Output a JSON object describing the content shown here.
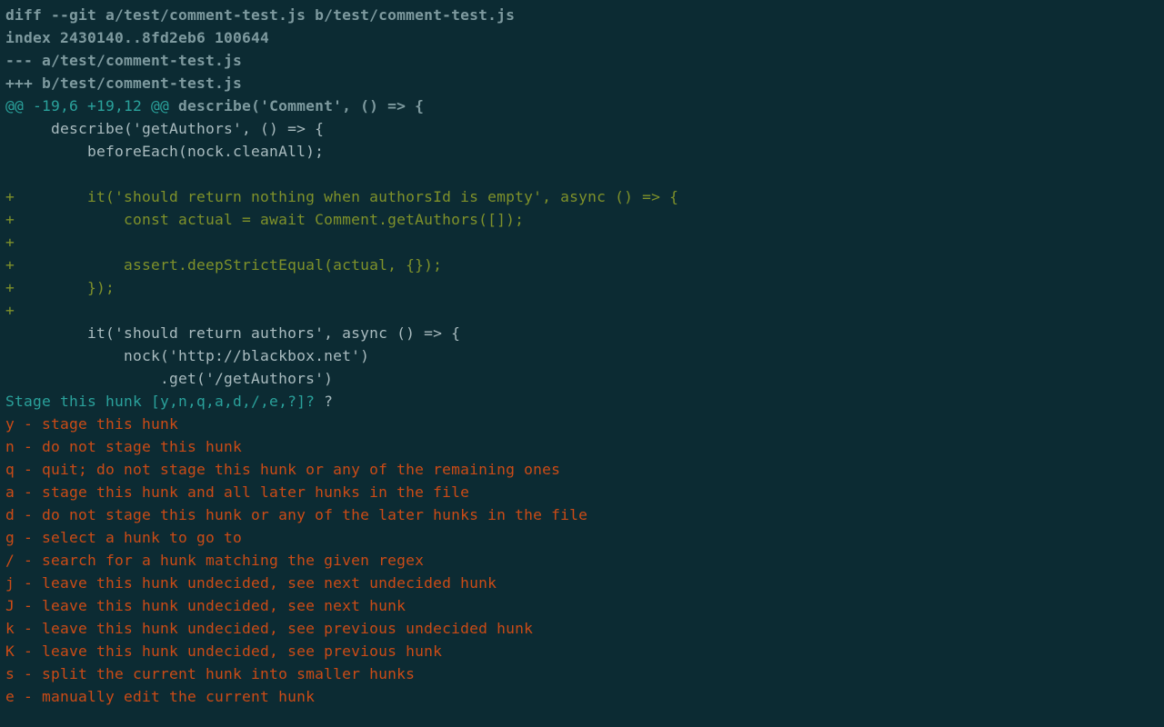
{
  "diff": {
    "header": [
      "diff --git a/test/comment-test.js b/test/comment-test.js",
      "index 2430140..8fd2eb6 100644",
      "--- a/test/comment-test.js",
      "+++ b/test/comment-test.js"
    ],
    "hunk": "@@ -19,6 +19,12 @@ ",
    "hunk_tail": "describe('Comment', () => {",
    "lines": [
      {
        "k": "ctx",
        "t": "     describe('getAuthors', () => {"
      },
      {
        "k": "ctx",
        "t": "         beforeEach(nock.cleanAll);"
      },
      {
        "k": "ctx",
        "t": " "
      },
      {
        "k": "add",
        "t": "+        it('should return nothing when authorsId is empty', async () => {"
      },
      {
        "k": "add",
        "t": "+            const actual = await Comment.getAuthors([]);"
      },
      {
        "k": "add",
        "t": "+"
      },
      {
        "k": "add",
        "t": "+            assert.deepStrictEqual(actual, {});"
      },
      {
        "k": "add",
        "t": "+        });"
      },
      {
        "k": "add",
        "t": "+"
      },
      {
        "k": "ctx",
        "t": "         it('should return authors', async () => {"
      },
      {
        "k": "ctx",
        "t": "             nock('http://blackbox.net')"
      },
      {
        "k": "ctx",
        "t": "                 .get('/getAuthors')"
      }
    ]
  },
  "prompt": {
    "question": "Stage this hunk [y,n,q,a,d,/,e,?]? ",
    "answer": "?"
  },
  "help_lines": [
    "y - stage this hunk",
    "n - do not stage this hunk",
    "q - quit; do not stage this hunk or any of the remaining ones",
    "a - stage this hunk and all later hunks in the file",
    "d - do not stage this hunk or any of the later hunks in the file",
    "g - select a hunk to go to",
    "/ - search for a hunk matching the given regex",
    "j - leave this hunk undecided, see next undecided hunk",
    "J - leave this hunk undecided, see next hunk",
    "k - leave this hunk undecided, see previous undecided hunk",
    "K - leave this hunk undecided, see previous hunk",
    "s - split the current hunk into smaller hunks",
    "e - manually edit the current hunk"
  ]
}
